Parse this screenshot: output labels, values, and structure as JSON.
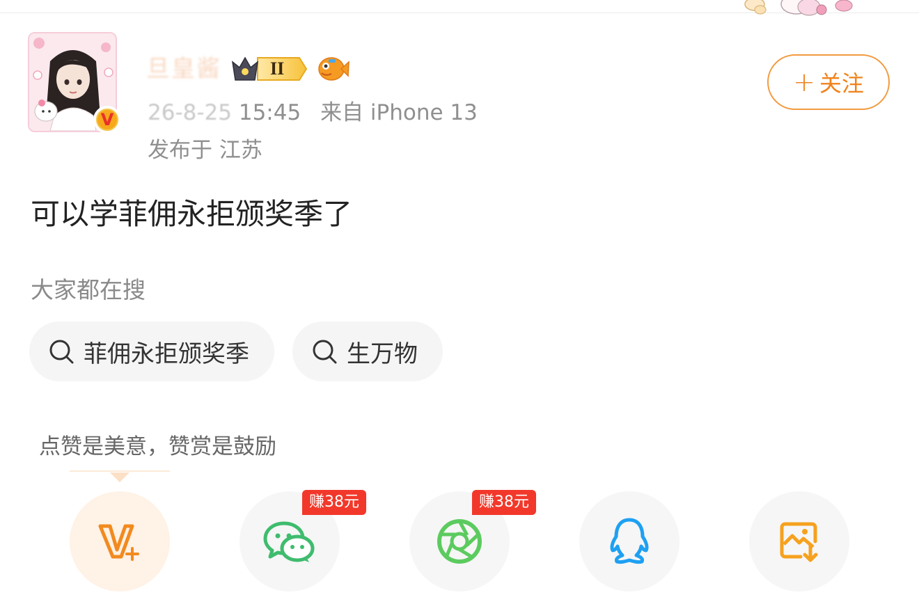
{
  "post": {
    "author": {
      "name": "旦皇酱",
      "level_badge": "II",
      "verified_mark": "V"
    },
    "date": "26-8-25",
    "time": "15:45",
    "source": "来自 iPhone 13",
    "location": "发布于 江苏",
    "follow_label": "关注",
    "text": "可以学菲佣永拒颁奖季了"
  },
  "search": {
    "heading": "大家都在搜",
    "chips": [
      {
        "label": "菲佣永拒颁奖季",
        "icon": "search-icon"
      },
      {
        "label": "生万物",
        "icon": "search-icon"
      }
    ]
  },
  "reward_tip": "点赞是美意，赞赏是鼓励",
  "share": {
    "items": [
      {
        "icon": "vplus-icon",
        "badge": ""
      },
      {
        "icon": "wechat-icon",
        "badge": "赚38元"
      },
      {
        "icon": "moments-icon",
        "badge": "赚38元"
      },
      {
        "icon": "qq-icon",
        "badge": ""
      },
      {
        "icon": "save-image-icon",
        "badge": ""
      }
    ]
  },
  "colors": {
    "accent_orange": "#f0821c",
    "badge_red": "#f2382a",
    "wechat_green": "#3fbc6e",
    "moments_green": "#5ccb5f",
    "qq_blue": "#1ea0f2",
    "save_orange": "#f6a11e"
  }
}
